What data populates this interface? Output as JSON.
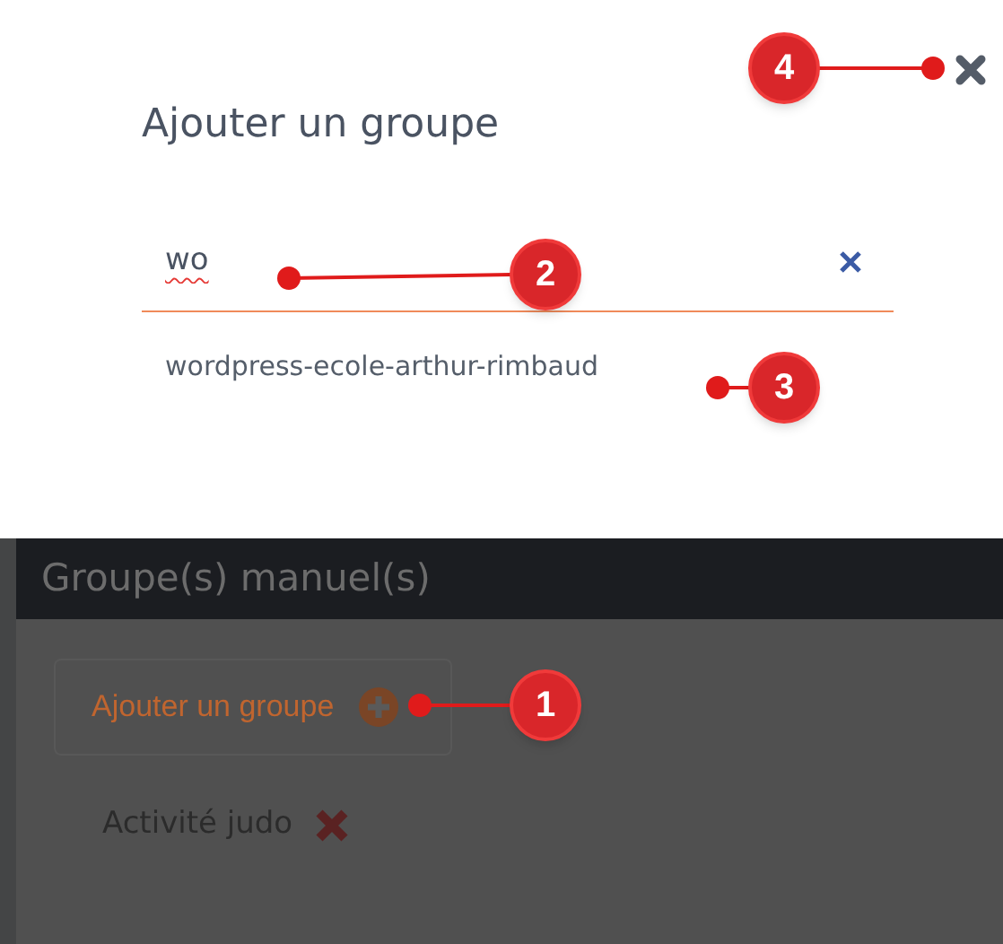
{
  "dialog": {
    "title": "Ajouter un groupe",
    "search": {
      "value": "wo"
    },
    "suggestions": [
      "wordpress-ecole-arthur-rimbaud"
    ]
  },
  "background": {
    "section_title": "Groupe(s) manuel(s)",
    "add_button": {
      "label": "Ajouter un groupe"
    },
    "groups": [
      {
        "name": "Activité judo"
      }
    ]
  },
  "callouts": [
    {
      "number": "4"
    },
    {
      "number": "2"
    },
    {
      "number": "3"
    },
    {
      "number": "1"
    }
  ]
}
